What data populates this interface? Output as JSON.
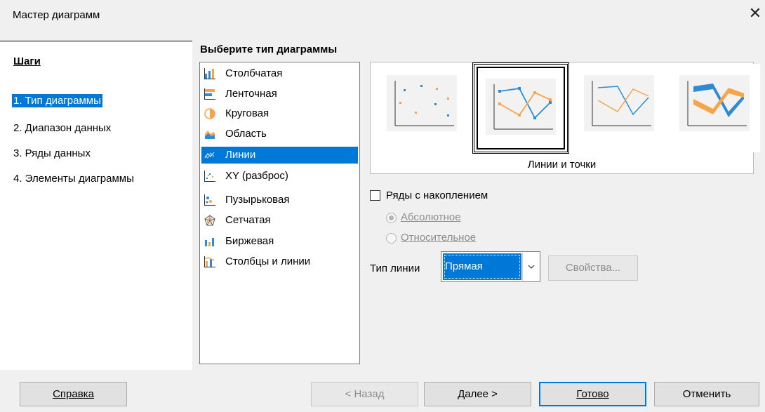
{
  "window": {
    "title": "Мастер диаграмм",
    "close_glyph": "✕"
  },
  "steps": {
    "heading": "Шаги",
    "items": [
      {
        "label": "1. Тип диаграммы",
        "selected": true
      },
      {
        "label": "2. Диапазон данных"
      },
      {
        "label": "3. Ряды данных"
      },
      {
        "label": "4. Элементы диаграммы"
      }
    ]
  },
  "chart_type": {
    "heading": "Выберите тип диаграммы",
    "types": [
      {
        "label": "Столбчатая",
        "icon": "column-chart-icon"
      },
      {
        "label": "Ленточная",
        "icon": "bar-chart-icon"
      },
      {
        "label": "Круговая",
        "icon": "pie-chart-icon"
      },
      {
        "label": "Область",
        "icon": "area-chart-icon"
      },
      {
        "label": "Линии",
        "icon": "line-chart-icon",
        "selected": true
      },
      {
        "label": "XY (разброс)",
        "icon": "scatter-chart-icon"
      },
      {
        "label": "Пузырьковая",
        "icon": "bubble-chart-icon"
      },
      {
        "label": "Сетчатая",
        "icon": "net-chart-icon"
      },
      {
        "label": "Биржевая",
        "icon": "stock-chart-icon"
      },
      {
        "label": "Столбцы и линии",
        "icon": "column-line-chart-icon"
      }
    ],
    "selected_variant_label": "Линии и точки"
  },
  "options": {
    "stacked_label": "Ряды с накоплением",
    "absolute_label": "Абсолютное",
    "relative_label": "Относительное",
    "line_type_label": "Тип линии",
    "line_type_value": "Прямая",
    "properties_label": "Свойства..."
  },
  "buttons": {
    "help": "Справка",
    "back": "< Назад",
    "next": "Далее >",
    "finish": "Готово",
    "cancel": "Отменить"
  },
  "colors": {
    "accent": "#0078d7",
    "series_blue": "#2e8bd3",
    "series_orange": "#f7a44a"
  }
}
